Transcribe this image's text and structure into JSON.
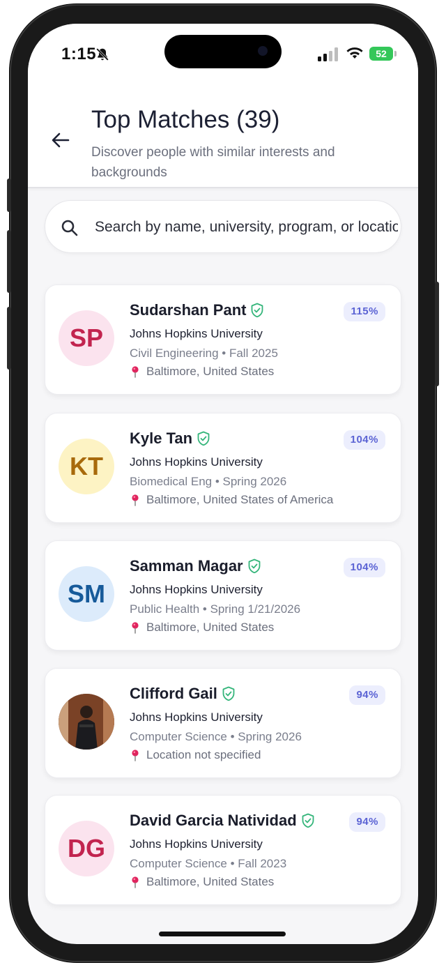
{
  "status_bar": {
    "time": "1:15",
    "battery": "52"
  },
  "header": {
    "title": "Top Matches (39)",
    "subtitle": "Discover people with similar interests and backgrounds"
  },
  "search": {
    "placeholder": "Search by name, university, program, or location"
  },
  "matches": [
    {
      "initials": "SP",
      "name": "Sudarshan Pant",
      "match": "115%",
      "university": "Johns Hopkins University",
      "program": "Civil Engineering • Fall 2025",
      "location": "Baltimore, United States",
      "avatar_bg": "#fbe3ee",
      "avatar_fg": "#c2244f",
      "shield_color": "#34b57a"
    },
    {
      "initials": "KT",
      "name": "Kyle Tan",
      "match": "104%",
      "university": "Johns Hopkins University",
      "program": "Biomedical Eng • Spring 2026",
      "location": "Baltimore, United States of America",
      "avatar_bg": "#fdf3c4",
      "avatar_fg": "#a86a0c",
      "shield_color": "#34b57a"
    },
    {
      "initials": "SM",
      "name": "Samman Magar",
      "match": "104%",
      "university": "Johns Hopkins University",
      "program": "Public Health • Spring 1/21/2026",
      "location": "Baltimore, United States",
      "avatar_bg": "#dcebfb",
      "avatar_fg": "#165a9a",
      "shield_color": "#34b57a"
    },
    {
      "initials": "",
      "name": "Clifford Gail",
      "match": "94%",
      "university": "Johns Hopkins University",
      "program": "Computer Science • Spring 2026",
      "location": "Location not specified",
      "avatar_bg": "#6b3a22",
      "avatar_fg": "#ffffff",
      "shield_color": "#34b57a"
    },
    {
      "initials": "DG",
      "name": "David Garcia Natividad",
      "match": "94%",
      "university": "Johns Hopkins University",
      "program": "Computer Science • Fall 2023",
      "location": "Baltimore, United States",
      "avatar_bg": "#fbe3ee",
      "avatar_fg": "#c2244f",
      "shield_color": "#34b57a"
    }
  ]
}
